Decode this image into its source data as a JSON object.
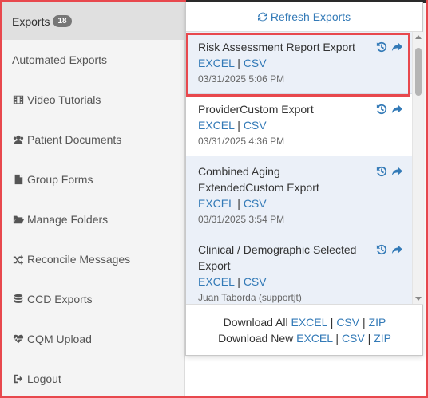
{
  "sidebar": {
    "items": [
      {
        "label": "Exports",
        "badge": "18",
        "icon": "none"
      },
      {
        "label": "Automated Exports",
        "icon": "none"
      },
      {
        "label": "Video Tutorials",
        "icon": "film-icon"
      },
      {
        "label": "Patient Documents",
        "icon": "users-icon"
      },
      {
        "label": "Group Forms",
        "icon": "file-icon"
      },
      {
        "label": "Manage Folders",
        "icon": "folder-open-icon"
      },
      {
        "label": "Reconcile Messages",
        "icon": "random-icon"
      },
      {
        "label": "CCD Exports",
        "icon": "database-icon"
      },
      {
        "label": "CQM Upload",
        "icon": "heartbeat-icon"
      },
      {
        "label": "Logout",
        "icon": "sign-out-icon"
      }
    ]
  },
  "panel": {
    "refresh_label": "Refresh Exports",
    "exports": [
      {
        "title": "Risk Assessment Report Export",
        "excel": "EXCEL",
        "sep": "|",
        "csv": "CSV",
        "meta": "03/31/2025 5:06 PM"
      },
      {
        "title": "ProviderCustom Export",
        "excel": "EXCEL",
        "sep": "|",
        "csv": "CSV",
        "meta": "03/31/2025 4:36 PM"
      },
      {
        "title": "Combined Aging ExtendedCustom Export",
        "excel": "EXCEL",
        "sep": "|",
        "csv": "CSV",
        "meta": "03/31/2025 3:54 PM"
      },
      {
        "title": "Clinical / Demographic Selected Export",
        "excel": "EXCEL",
        "sep": "|",
        "csv": "CSV",
        "meta": "Juan Taborda (supportjt)"
      }
    ],
    "footer": {
      "all_label": "Download All",
      "new_label": "Download New",
      "excel": "EXCEL",
      "csv": "CSV",
      "zip": "ZIP",
      "sep": "|"
    }
  },
  "colors": {
    "accent": "#337ab7",
    "highlight": "#e8484d"
  }
}
